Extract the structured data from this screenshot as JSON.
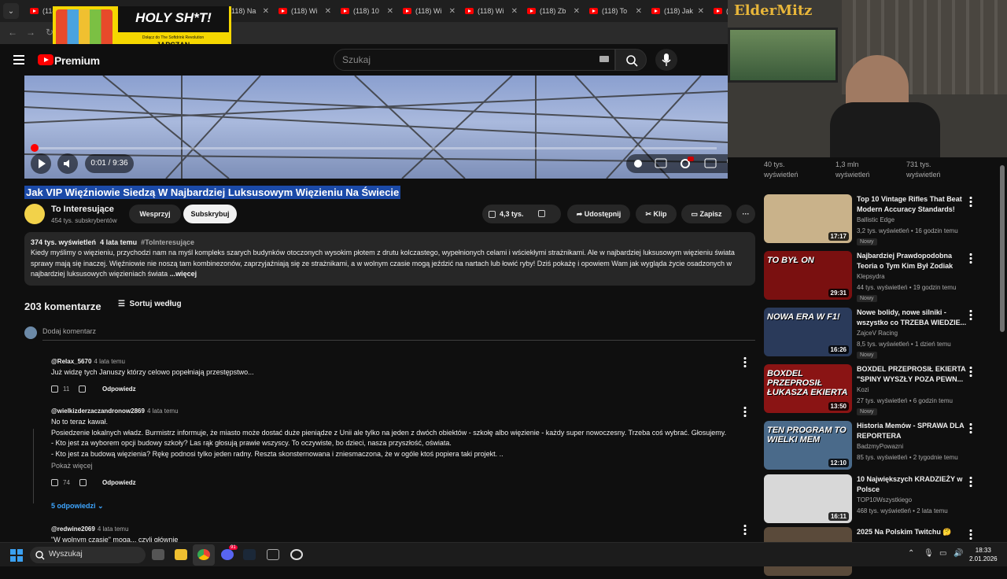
{
  "tabs": [
    {
      "label": "(118) Jak"
    },
    {
      "label": "(118) K"
    },
    {
      "label": ""
    },
    {
      "label": "(118) Na"
    },
    {
      "label": "(118) Wi"
    },
    {
      "label": "(118) 10"
    },
    {
      "label": "(118) Wi"
    },
    {
      "label": "(118) Wi"
    },
    {
      "label": "(118) Zb"
    },
    {
      "label": "(118) To"
    },
    {
      "label": "(118) Jak"
    },
    {
      "label": "(118)"
    }
  ],
  "ad": {
    "headline": "HOLY SH*T!",
    "subline": "Dołącz do The Softdrink Revolution",
    "brand": "JAPCZAN",
    "promo": "10% zniżki z kodem"
  },
  "header": {
    "logo_text": "Premium",
    "search_placeholder": "Szukaj"
  },
  "player": {
    "time": "0:01 / 9:36",
    "progress": 0.002
  },
  "video": {
    "title": "Jak VIP Więźniowie Siedzą W Najbardziej Luksusowym Więzieniu Na Świecie",
    "channel": "To Interesujące",
    "subscribers": "454 tys. subskrybentów",
    "support_label": "Wesprzyj",
    "subscribe_label": "Subskrybuj",
    "likes": "4,3 tys.",
    "share_label": "Udostępnij",
    "clip_label": "Klip",
    "save_label": "Zapisz"
  },
  "description": {
    "views": "374 tys. wyświetleń",
    "age": "4 lata temu",
    "tag": "#ToInteresujące",
    "text": "Kiedy myślimy o więzieniu, przychodzi nam na myśl kompleks szarych budynków otoczonych wysokim płotem z drutu kolczastego, wypełnionych celami i wściekłymi strażnikami. Ale w najbardziej luksusowym więzieniu świata sprawy mają się inaczej. Więźniowie nie noszą tam kombinezonów, zaprzyjaźniają się ze strażnikami, a w wolnym czasie mogą jeździć na nartach lub łowić ryby! Dziś pokażę i opowiem Wam jak wygląda życie osadzonych w najbardziej luksusowych więzieniach świata",
    "more": "...więcej"
  },
  "comments_section": {
    "count": "203 komentarze",
    "sort_label": "Sortuj według",
    "add_placeholder": "Dodaj komentarz",
    "reply_label": "Odpowiedz",
    "show_more": "Pokaż więcej",
    "replies_label": "5 odpowiedzi"
  },
  "comments": [
    {
      "author": "@Relax_5670",
      "age": "4 lata temu",
      "text": "Już widzę tych Januszy którzy celowo popełniają przestępstwo...",
      "likes": "11"
    },
    {
      "author": "@wielkizderzaczandronow2869",
      "age": "4 lata temu",
      "lines": [
        "No to teraz kawał.",
        "Posiedzenie lokalnych władz. Burmistrz informuje, że miasto może dostać duże pieniądze z Unii ale tylko na jeden z dwóch obiektów - szkołę albo więzienie - każdy super nowoczesny. Trzeba coś wybrać. Głosujemy.",
        "- Kto jest za wyborem opcji budowy szkoły? Las rąk głosują prawie wszyscy. To oczywiste, bo dzieci, nasza przyszłość, oświata.",
        "- Kto jest za budową więzienia? Rękę podnosi tylko jeden radny. Reszta skonsternowana i zniesmaczona, że w ogóle ktoś popiera taki projekt. .."
      ],
      "likes": "74"
    },
    {
      "author": "@redwine2069",
      "age": "4 lata temu",
      "text": "\"W wolnym czasie\" mogą... czyli głównie"
    }
  ],
  "side_stats": [
    {
      "views": "40 tys.",
      "label": "wyświetleń"
    },
    {
      "views": "1,3 mln",
      "label": "wyświetleń"
    },
    {
      "views": "731 tys.",
      "label": "wyświetleń"
    }
  ],
  "side_videos": [
    {
      "title": "Top 10 Vintage Rifles That Beat Modern Accuracy Standards!",
      "channel": "Ballistic Edge",
      "stats": "3,2 tys. wyświetleń • 16 godzin temu",
      "badge": "Nowy",
      "duration": "17:17",
      "thumb_text": "",
      "color": "#c9b28a"
    },
    {
      "title": "Najbardziej Prawdopodobna Teoria o Tym Kim Był Zodiak",
      "channel": "Klepsydra",
      "stats": "44 tys. wyświetleń • 19 godzin temu",
      "badge": "Nowy",
      "duration": "29:31",
      "thumb_text": "TO BYŁ ON",
      "color": "#7a1010"
    },
    {
      "title": "Nowe bolidy, nowe silniki - wszystko co TRZEBA WIEDZIE...",
      "channel": "ZajceV Racing",
      "stats": "8,5 tys. wyświetleń • 1 dzień temu",
      "badge": "Nowy",
      "duration": "16:26",
      "thumb_text": "NOWA ERA W F1!",
      "color": "#2a3a5a"
    },
    {
      "title": "BOXDEL PRZEPROSIŁ EKIERTA \"SPINY WYSZŁY POZA PEWN...",
      "channel": "Kozi",
      "stats": "27 tys. wyświetleń • 6 godzin temu",
      "badge": "Nowy",
      "duration": "13:50",
      "thumb_text": "BOXDEL PRZEPROSIŁ ŁUKASZA EKIERTA",
      "color": "#8a1414"
    },
    {
      "title": "Historia Memów - SPRAWA DLA REPORTERA",
      "channel": "BadzmyPowazni",
      "stats": "85 tys. wyświetleń • 2 tygodnie temu",
      "badge": "",
      "duration": "12:10",
      "thumb_text": "TEN PROGRAM TO WIELKI MEM",
      "color": "#4a6a8a"
    },
    {
      "title": "10 Największych KRADZIEŻY w Polsce",
      "channel": "TOP10Wszystkiego",
      "stats": "468 tys. wyświetleń • 2 lata temu",
      "badge": "",
      "duration": "16:11",
      "thumb_text": "",
      "color": "#d8d8d8"
    },
    {
      "title": "2025 Na Polskim Twitchu 🤔",
      "channel": "",
      "stats": "",
      "badge": "",
      "duration": "",
      "thumb_text": "",
      "color": "#5a4a3a"
    }
  ],
  "webcam_overlay": {
    "text": "ElderMitz"
  },
  "taskbar": {
    "search_placeholder": "Wyszukaj",
    "time": "18:33",
    "date": "2.01.2026",
    "discord_badge": "91"
  }
}
